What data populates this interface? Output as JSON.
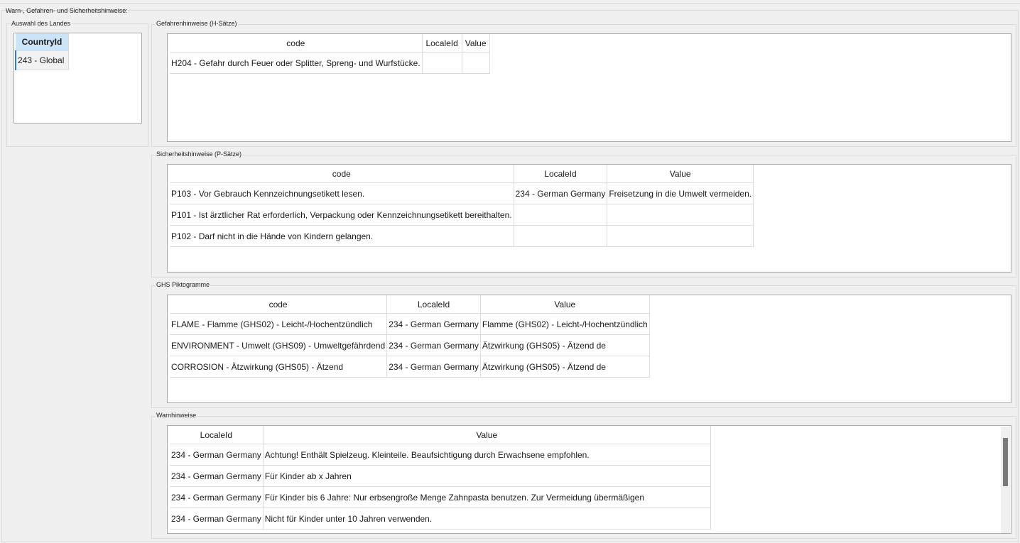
{
  "window": {
    "title": "Warn-, Gefahren- und Sicherheitshinweise:"
  },
  "country": {
    "label": "Auswahl des Landes",
    "header": "CountryId",
    "rows": [
      "243 - Global"
    ]
  },
  "h_phrases": {
    "label": "Gefahrenhinweise (H-Sätze)",
    "headers": [
      "code",
      "LocaleId",
      "Value"
    ],
    "rows": [
      [
        "H204 - Gefahr durch Feuer oder Splitter, Spreng- und Wurfstücke.",
        "",
        ""
      ]
    ]
  },
  "p_phrases": {
    "label": "Sicherheitshinweise (P-Sätze)",
    "headers": [
      "code",
      "LocaleId",
      "Value"
    ],
    "rows": [
      [
        "P103 - Vor Gebrauch Kennzeichnungsetikett lesen.",
        "234 - German Germany",
        "Freisetzung in die Umwelt vermeiden."
      ],
      [
        "P101 - Ist ärztlicher Rat erforderlich, Verpackung oder Kennzeichnungsetikett bereithalten.",
        "",
        ""
      ],
      [
        "P102 - Darf nicht in die Hände von Kindern gelangen.",
        "",
        ""
      ]
    ]
  },
  "ghs": {
    "label": "GHS Piktogramme",
    "headers": [
      "code",
      "LocaleId",
      "Value"
    ],
    "rows": [
      [
        "FLAME - Flamme (GHS02) - Leicht-/Hochentzündlich",
        "234 - German Germany",
        "Flamme (GHS02) - Leicht-/Hochentzündlich"
      ],
      [
        "ENVIRONMENT - Umwelt (GHS09) - Umweltgefährdend",
        "234 - German Germany",
        "Ätzwirkung (GHS05) - Ätzend de"
      ],
      [
        "CORROSION - Ätzwirkung (GHS05) - Ätzend",
        "234 - German Germany",
        "Ätzwirkung (GHS05) - Ätzend de"
      ]
    ]
  },
  "warnings": {
    "label": "Warnhinweise",
    "headers": [
      "LocaleId",
      "Value"
    ],
    "rows": [
      [
        "234 - German Germany",
        "Achtung! Enthält Spielzeug. Kleinteile. Beaufsichtigung durch Erwachsene empfohlen."
      ],
      [
        "234 - German Germany",
        "Für Kinder ab x Jahren"
      ],
      [
        "234 - German Germany",
        "Für Kinder bis 6 Jahre: Nur erbsengroße Menge Zahnpasta benutzen. Zur Vermeidung übermäßigen"
      ],
      [
        "234 - German Germany",
        "Nicht für Kinder unter 10 Jahren verwenden."
      ]
    ]
  }
}
